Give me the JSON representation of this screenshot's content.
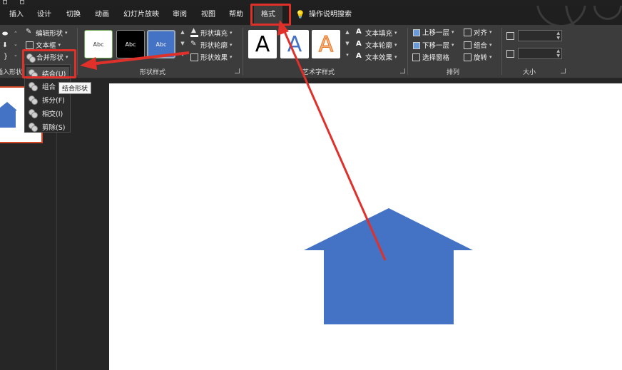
{
  "tabs": [
    "插入",
    "设计",
    "切换",
    "动画",
    "幻灯片放映",
    "审阅",
    "视图",
    "帮助",
    "格式"
  ],
  "search_label": "操作说明搜索",
  "insert_shapes": {
    "edit_shape": "编辑形状",
    "text_box": "文本框",
    "merge_shapes": "合并形状",
    "group_label": "插入形状"
  },
  "shape_styles": {
    "swatches": [
      "Abc",
      "Abc",
      "Abc"
    ],
    "fill": "形状填充",
    "outline": "形状轮廓",
    "effects": "形状效果",
    "group_label": "形状样式"
  },
  "wordart": {
    "letters": [
      "A",
      "A",
      "A"
    ],
    "text_fill": "文本填充",
    "text_outline": "文本轮廓",
    "text_effects": "文本效果",
    "group_label": "艺术字样式"
  },
  "arrange": {
    "bring_forward": "上移一层",
    "send_backward": "下移一层",
    "selection_pane": "选择窗格",
    "align": "对齐",
    "group": "组合",
    "rotate": "旋转",
    "group_label": "排列"
  },
  "size": {
    "group_label": "大小"
  },
  "merge_menu": {
    "items": [
      "结合(U)",
      "组合",
      "拆分(F)",
      "相交(I)",
      "剪除(S)"
    ],
    "tooltip": "结合形状"
  },
  "colors": {
    "accent_red": "#e0302a",
    "shape_blue": "#4472c4"
  }
}
